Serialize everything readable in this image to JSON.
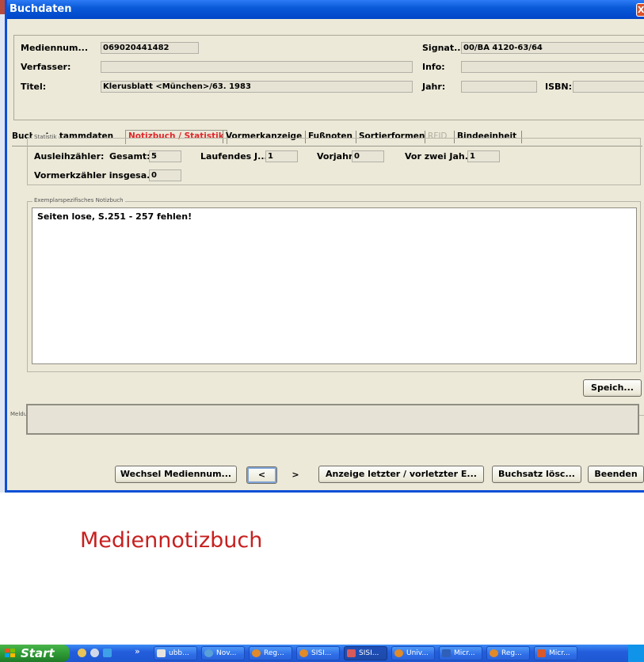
{
  "window": {
    "title": "Buchdaten",
    "close_glyph": "X"
  },
  "header": {
    "mediennum_label": "Mediennum...",
    "mediennum_value": "069020441482",
    "signat_label": "Signat...",
    "signat_value": "00/BA 4120-63/64",
    "verfasser_label": "Verfasser:",
    "verfasser_value": "",
    "info_label": "Info:",
    "info_value": "",
    "titel_label": "Titel:",
    "titel_value": "Klerusblatt <München>/63. 1983",
    "jahr_label": "Jahr:",
    "jahr_value": "",
    "isbn_label": "ISBN:",
    "isbn_value": ""
  },
  "tabs": [
    {
      "label": "Buchsatzstammdaten",
      "state": "normal"
    },
    {
      "label": "Notizbuch / Statistik",
      "state": "active"
    },
    {
      "label": "Vormerkanzeige",
      "state": "normal"
    },
    {
      "label": "Fußnoten",
      "state": "normal"
    },
    {
      "label": "Sortierformen",
      "state": "normal"
    },
    {
      "label": "RFID",
      "state": "disabled"
    },
    {
      "label": "Bindeeinheit",
      "state": "normal"
    }
  ],
  "statistik": {
    "group_title": "Statistik",
    "ausleih_label": "Ausleihzähler:",
    "gesamt_label": "Gesamt:",
    "gesamt_value": "5",
    "laufendes_label": "Laufendes J...",
    "laufendes_value": "1",
    "vorjahr_label": "Vorjahr:",
    "vorjahr_value": "0",
    "vorzwei_label": "Vor zwei Jah...",
    "vorzwei_value": "1",
    "vormerk_label": "Vormerkzähler insgesa...",
    "vormerk_value": "0"
  },
  "notizbuch": {
    "group_title": "Exemplarspezifisches Notizbuch",
    "text": "Seiten lose, S.251 - 257 fehlen!",
    "save_label": "Speich..."
  },
  "meldungen": {
    "group_title": "Meldungen",
    "text": ""
  },
  "footer": {
    "wechsel_label": "Wechsel Mediennum...",
    "prev_label": "<",
    "next_label": ">",
    "anzeige_label": "Anzeige letzter / vorletzter E...",
    "loeschen_label": "Buchsatz lösc...",
    "beenden_label": "Beenden"
  },
  "caption": "Mediennotizbuch",
  "taskbar": {
    "start_label": "Start",
    "more_glyph": "»",
    "buttons": [
      "ubb...",
      "Nov...",
      "Reg...",
      "SISI...",
      "SISI...",
      "Univ...",
      "Micr...",
      "Reg...",
      "Micr..."
    ],
    "colors": {
      "start": "#2f9b36",
      "bar": "#245edc",
      "title_bar": "#0a5ad8",
      "caption": "#c7201f"
    }
  }
}
